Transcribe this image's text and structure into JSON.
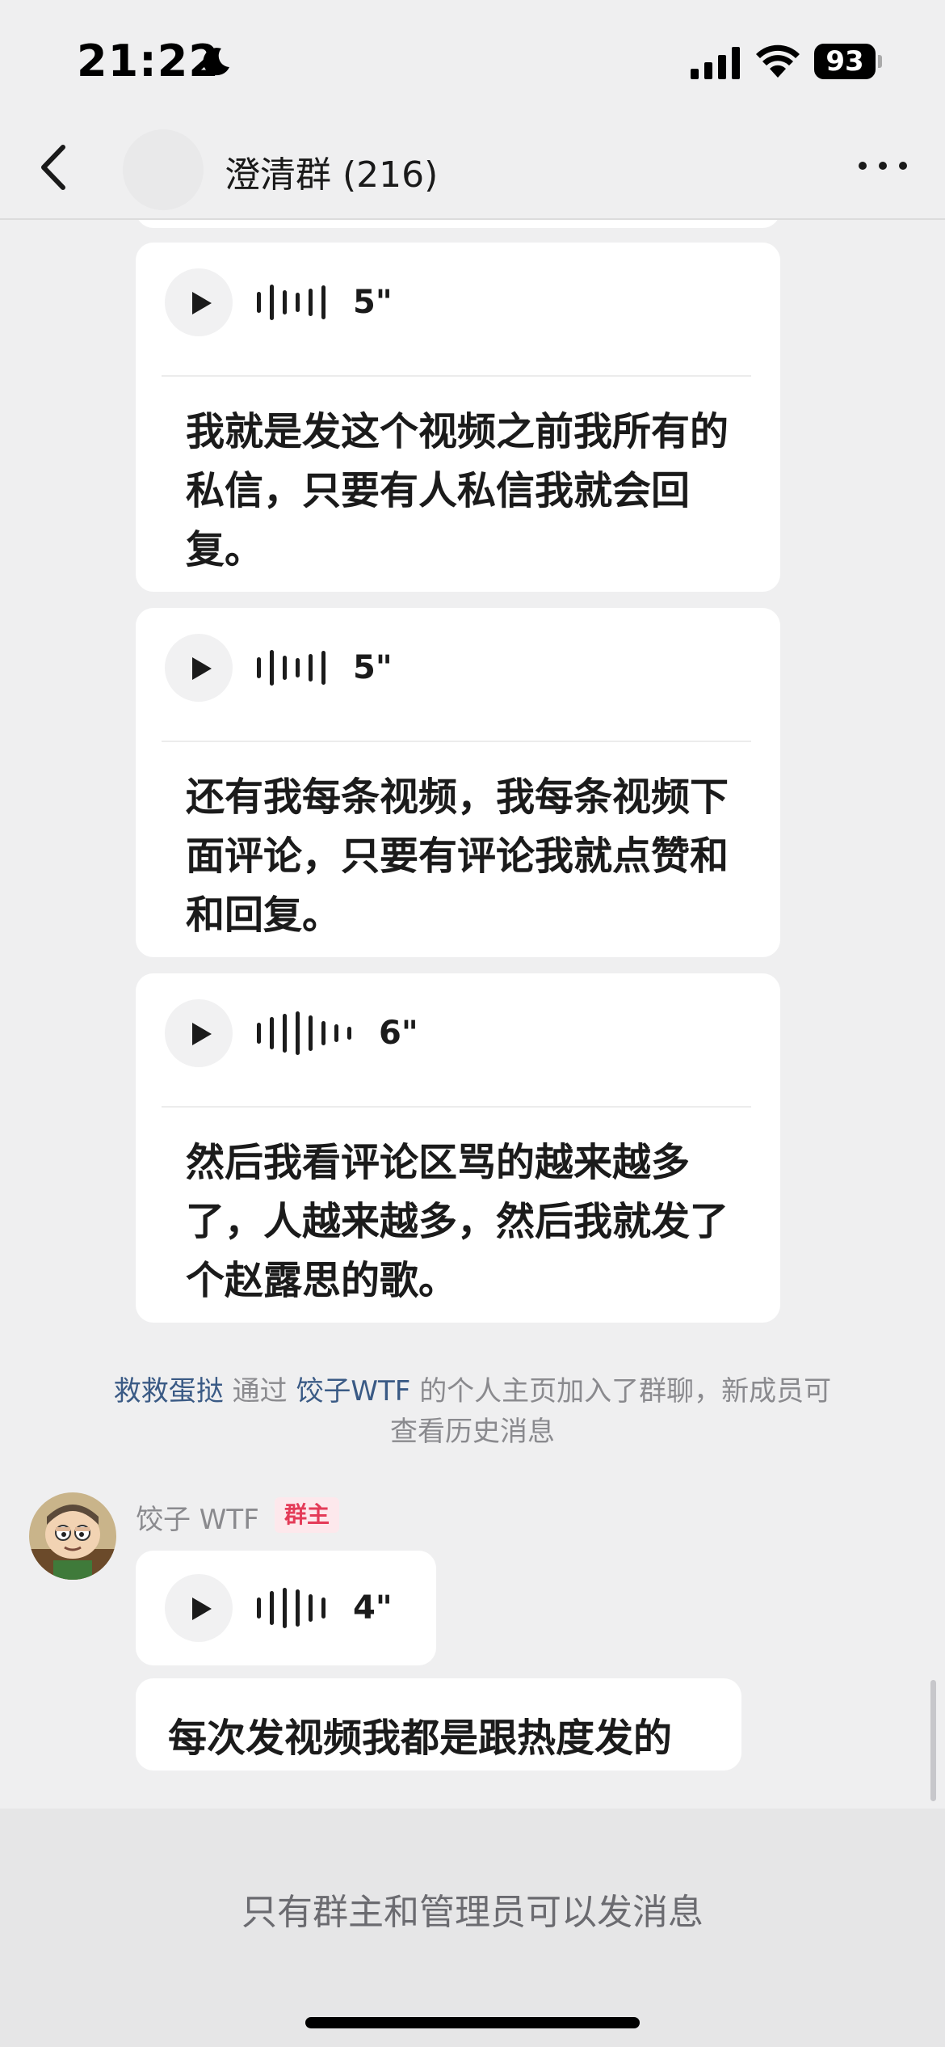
{
  "status_bar": {
    "time": "21:22",
    "battery_level": "93"
  },
  "header": {
    "title": "澄清群 (216)"
  },
  "messages": [
    {
      "type": "voice",
      "duration": "5\"",
      "transcript": "我就是发这个视频之前我所有的私信，只要有人私信我就会回复。"
    },
    {
      "type": "voice",
      "duration": "5\"",
      "transcript": "还有我每条视频，我每条视频下面评论，只要有评论我就点赞和和回复。"
    },
    {
      "type": "voice",
      "duration": "6\"",
      "transcript": "然后我看评论区骂的越来越多了，人越来越多，然后我就发了个赵露思的歌。"
    }
  ],
  "system_message": {
    "user": "救救蛋挞",
    "via": "通过",
    "inviter": "饺子WTF",
    "text": "的个人主页加入了群聊，新成员可查看历史消息"
  },
  "last_sender": {
    "name": "饺子 WTF",
    "role": "群主",
    "voice_duration": "4\"",
    "text": "每次发视频我都是跟热度发的"
  },
  "footer": {
    "notice": "只有群主和管理员可以发消息"
  },
  "colors": {
    "background": "#efeff0",
    "bubble": "#ffffff",
    "link": "#3a5a85",
    "badge": "#e43b58"
  }
}
